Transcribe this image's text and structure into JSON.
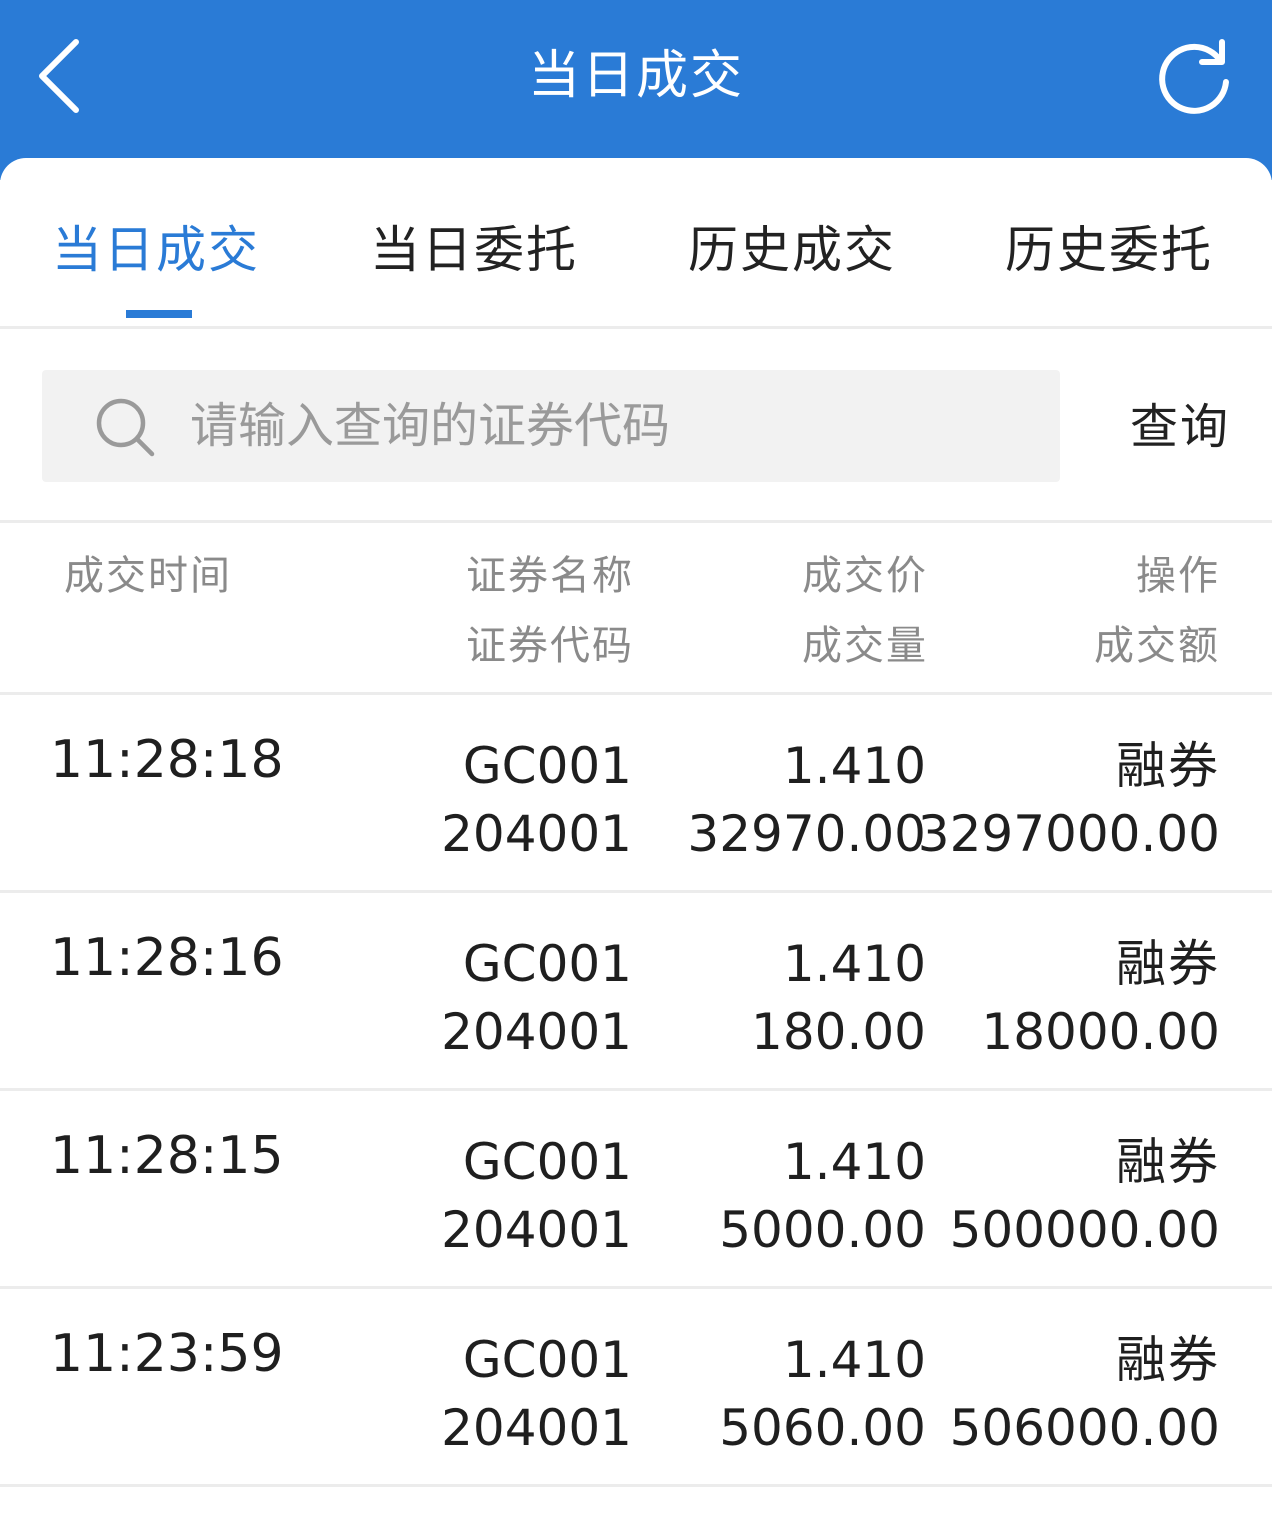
{
  "header": {
    "title": "当日成交",
    "back_icon": "chevron-left-icon",
    "refresh_icon": "refresh-icon"
  },
  "tabs": [
    {
      "label": "当日成交",
      "active": true
    },
    {
      "label": "当日委托",
      "active": false
    },
    {
      "label": "历史成交",
      "active": false
    },
    {
      "label": "历史委托",
      "active": false
    }
  ],
  "search": {
    "placeholder": "请输入查询的证券代码",
    "value": "",
    "button_label": "查询",
    "icon": "search-icon"
  },
  "table": {
    "headers": {
      "time": "成交时间",
      "name": "证券名称",
      "code": "证券代码",
      "price": "成交价",
      "quantity": "成交量",
      "operation": "操作",
      "amount": "成交额"
    },
    "rows": [
      {
        "time": "11:28:18",
        "name": "GC001",
        "code": "204001",
        "price": "1.410",
        "quantity": "32970.00",
        "operation": "融券",
        "amount": "3297000.00"
      },
      {
        "time": "11:28:16",
        "name": "GC001",
        "code": "204001",
        "price": "1.410",
        "quantity": "180.00",
        "operation": "融券",
        "amount": "18000.00"
      },
      {
        "time": "11:28:15",
        "name": "GC001",
        "code": "204001",
        "price": "1.410",
        "quantity": "5000.00",
        "operation": "融券",
        "amount": "500000.00"
      },
      {
        "time": "11:23:59",
        "name": "GC001",
        "code": "204001",
        "price": "1.410",
        "quantity": "5060.00",
        "operation": "融券",
        "amount": "506000.00"
      }
    ]
  },
  "colors": {
    "primary": "#2a7bd6",
    "text": "#1f1f1f",
    "muted": "#8a8a8a",
    "divider": "#ececec"
  }
}
